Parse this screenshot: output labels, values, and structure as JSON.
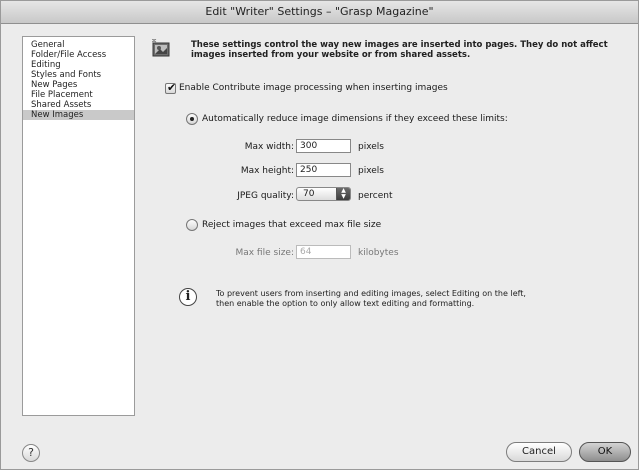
{
  "window": {
    "title": "Edit \"Writer\" Settings – \"Grasp Magazine\""
  },
  "sidebar": {
    "items": [
      {
        "label": "General",
        "selected": false
      },
      {
        "label": "Folder/File Access",
        "selected": false
      },
      {
        "label": "Editing",
        "selected": false
      },
      {
        "label": "Styles and Fonts",
        "selected": false
      },
      {
        "label": "New Pages",
        "selected": false
      },
      {
        "label": "File Placement",
        "selected": false
      },
      {
        "label": "Shared Assets",
        "selected": false
      },
      {
        "label": "New Images",
        "selected": true
      }
    ]
  },
  "header": {
    "icon": "image-settings-icon",
    "text": "These settings control the way new images are inserted into pages. They do not affect images inserted from your website or from shared assets."
  },
  "enable_processing": {
    "label": "Enable Contribute image processing when inserting images",
    "checked": true
  },
  "reduce_option": {
    "label": "Automatically reduce image dimensions if they exceed these limits:",
    "selected": true,
    "max_width": {
      "label": "Max width:",
      "value": "300",
      "unit": "pixels"
    },
    "max_height": {
      "label": "Max height:",
      "value": "250",
      "unit": "pixels"
    },
    "jpeg_quality": {
      "label": "JPEG quality:",
      "value": "70",
      "unit": "percent"
    }
  },
  "reject_option": {
    "label": "Reject images that exceed max file size",
    "selected": false,
    "max_file_size": {
      "label": "Max file size:",
      "value": "64",
      "unit": "kilobytes"
    }
  },
  "info": {
    "icon": "info-icon",
    "glyph": "i",
    "text_line1": "To prevent users from inserting and editing images, select Editing on the left,",
    "text_line2": "then enable the option to only allow text editing and formatting."
  },
  "footer": {
    "help_glyph": "?",
    "cancel_label": "Cancel",
    "ok_label": "OK"
  }
}
